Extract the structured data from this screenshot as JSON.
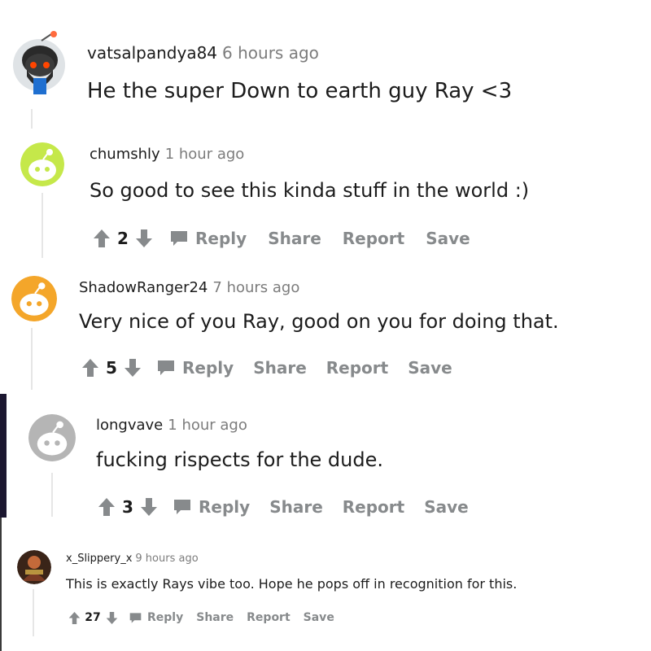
{
  "comments": [
    {
      "username": "vatsalpandya84",
      "time": "6 hours ago",
      "body": "He the super Down to earth guy Ray <3",
      "avatar_icon": "snoo-bearded-avatar-icon"
    },
    {
      "username": "chumshly",
      "time": "1 hour ago",
      "body": "So good to see this kinda stuff in the world :)",
      "votes": "2",
      "reply_label": "Reply",
      "share_label": "Share",
      "report_label": "Report",
      "save_label": "Save",
      "avatar_color": "#c5e84a"
    },
    {
      "username": "ShadowRanger24",
      "time": "7 hours ago",
      "body": "Very nice of you Ray, good on you for doing that.",
      "votes": "5",
      "reply_label": "Reply",
      "share_label": "Share",
      "report_label": "Report",
      "save_label": "Save",
      "avatar_color": "#f4a62a"
    },
    {
      "username": "longvave",
      "time": "1 hour ago",
      "body": "fucking rispects for the dude.",
      "votes": "3",
      "reply_label": "Reply",
      "share_label": "Share",
      "report_label": "Report",
      "save_label": "Save",
      "avatar_color": "#b5b5b5"
    },
    {
      "username": "x_Slippery_x",
      "time": "9 hours ago",
      "body": "This is exactly Rays vibe too. Hope he pops off in recognition for this.",
      "votes": "27",
      "reply_label": "Reply",
      "share_label": "Share",
      "report_label": "Report",
      "save_label": "Save",
      "avatar_icon": "user-photo-avatar-icon"
    }
  ],
  "colors": {
    "text": "#1c1c1c",
    "meta": "#7c7c7c",
    "action": "#878a8c",
    "thread_line": "#e6e6e6",
    "side_bar": "#1b1730"
  }
}
